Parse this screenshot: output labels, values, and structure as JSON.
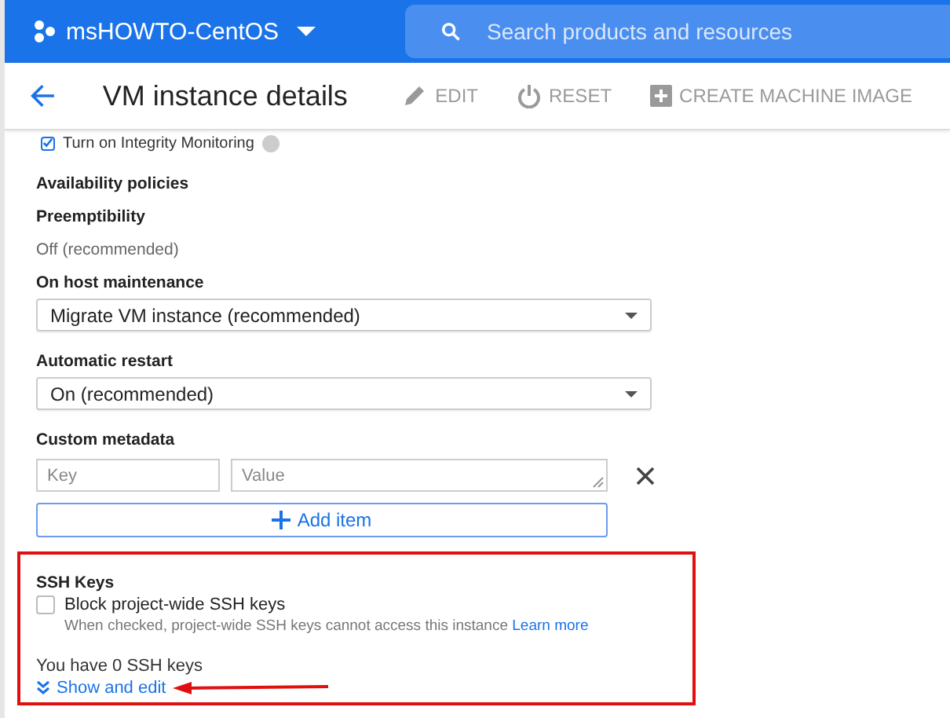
{
  "top_bar": {
    "project": "msHOWTO-CentOS",
    "search": {
      "placeholder": "Search products and resources"
    }
  },
  "header": {
    "title": "VM instance details",
    "actions": [
      {
        "label": "EDIT",
        "kind": "edit",
        "disabled": true
      },
      {
        "label": "RESET",
        "kind": "reset",
        "disabled": true
      },
      {
        "label": "CREATE MACHINE IMAGE",
        "kind": "create",
        "disabled": true
      }
    ]
  },
  "integrity_monitoring": {
    "label": "Turn on Integrity Monitoring",
    "checked": true
  },
  "availability_policies": {
    "heading": "Availability policies",
    "preemptibility": {
      "label": "Preemptibility",
      "value": "Off (recommended)"
    },
    "on_host_maintenance": {
      "label": "On host maintenance",
      "value": "Migrate VM instance (recommended)"
    },
    "automatic_restart": {
      "label": "Automatic restart",
      "value": "On (recommended)"
    }
  },
  "custom_metadata": {
    "heading": "Custom metadata",
    "key": {
      "placeholder": "Key"
    },
    "value": {
      "placeholder": "Value"
    },
    "add_button": "Add item"
  },
  "ssh_keys": {
    "heading": "SSH Keys",
    "block_project_wide": {
      "label": "Block project-wide SSH keys",
      "checked": false,
      "description": "When checked, project-wide SSH keys cannot access this instance",
      "link": "Learn more"
    },
    "count_text": "You have 0 SSH keys",
    "show_edit": "Show and edit"
  }
}
